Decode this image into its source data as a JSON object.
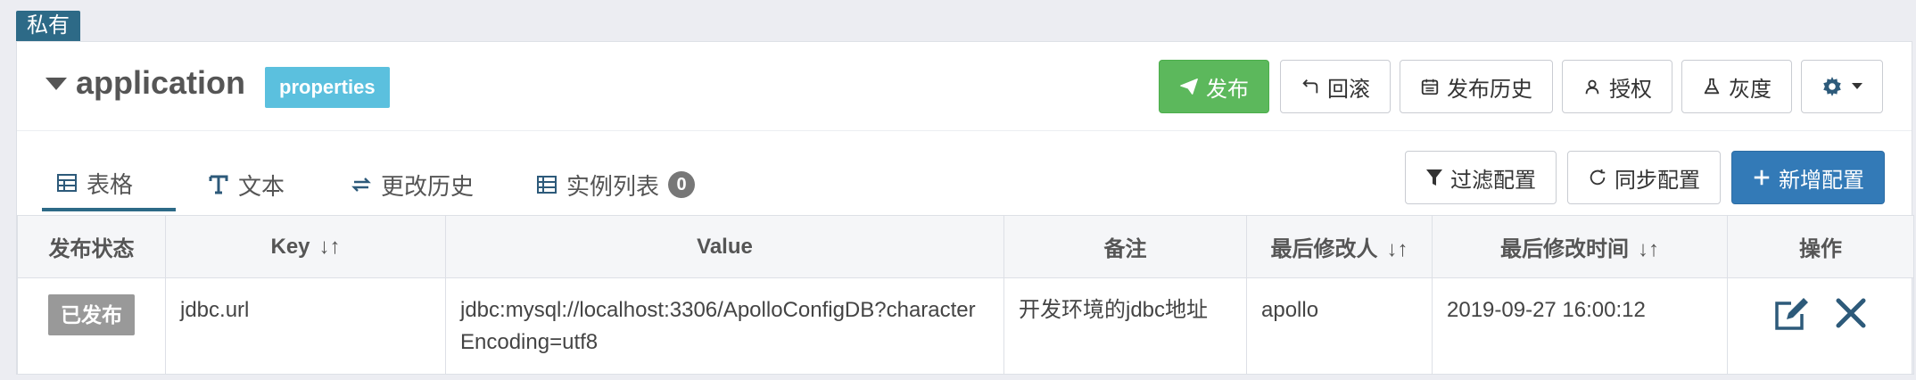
{
  "scope_badge": "私有",
  "namespace": {
    "name": "application",
    "format": "properties"
  },
  "toolbar": {
    "publish": "发布",
    "rollback": "回滚",
    "history": "发布历史",
    "auth": "授权",
    "gray": "灰度"
  },
  "tabs": [
    {
      "label": "表格",
      "icon": "table-icon",
      "active": true
    },
    {
      "label": "文本",
      "icon": "text-icon"
    },
    {
      "label": "更改历史",
      "icon": "change-history-icon"
    },
    {
      "label": "实例列表",
      "icon": "instances-icon",
      "count": "0"
    }
  ],
  "actions": {
    "filter": "过滤配置",
    "sync": "同步配置",
    "add": "新增配置"
  },
  "table": {
    "headers": [
      "发布状态",
      "Key",
      "Value",
      "备注",
      "最后修改人",
      "最后修改时间",
      "操作"
    ],
    "rows": [
      {
        "status": "已发布",
        "key": "jdbc.url",
        "value": "jdbc:mysql://localhost:3306/ApolloConfigDB?characterEncoding=utf8",
        "comment": "开发环境的jdbc地址",
        "modifier": "apollo",
        "modified_time": "2019-09-27 16:00:12"
      }
    ]
  },
  "colors": {
    "publish": "#5cb85c",
    "add": "#337ab7",
    "format_badge": "#5bc0de",
    "scope_badge": "#2d6a87"
  }
}
